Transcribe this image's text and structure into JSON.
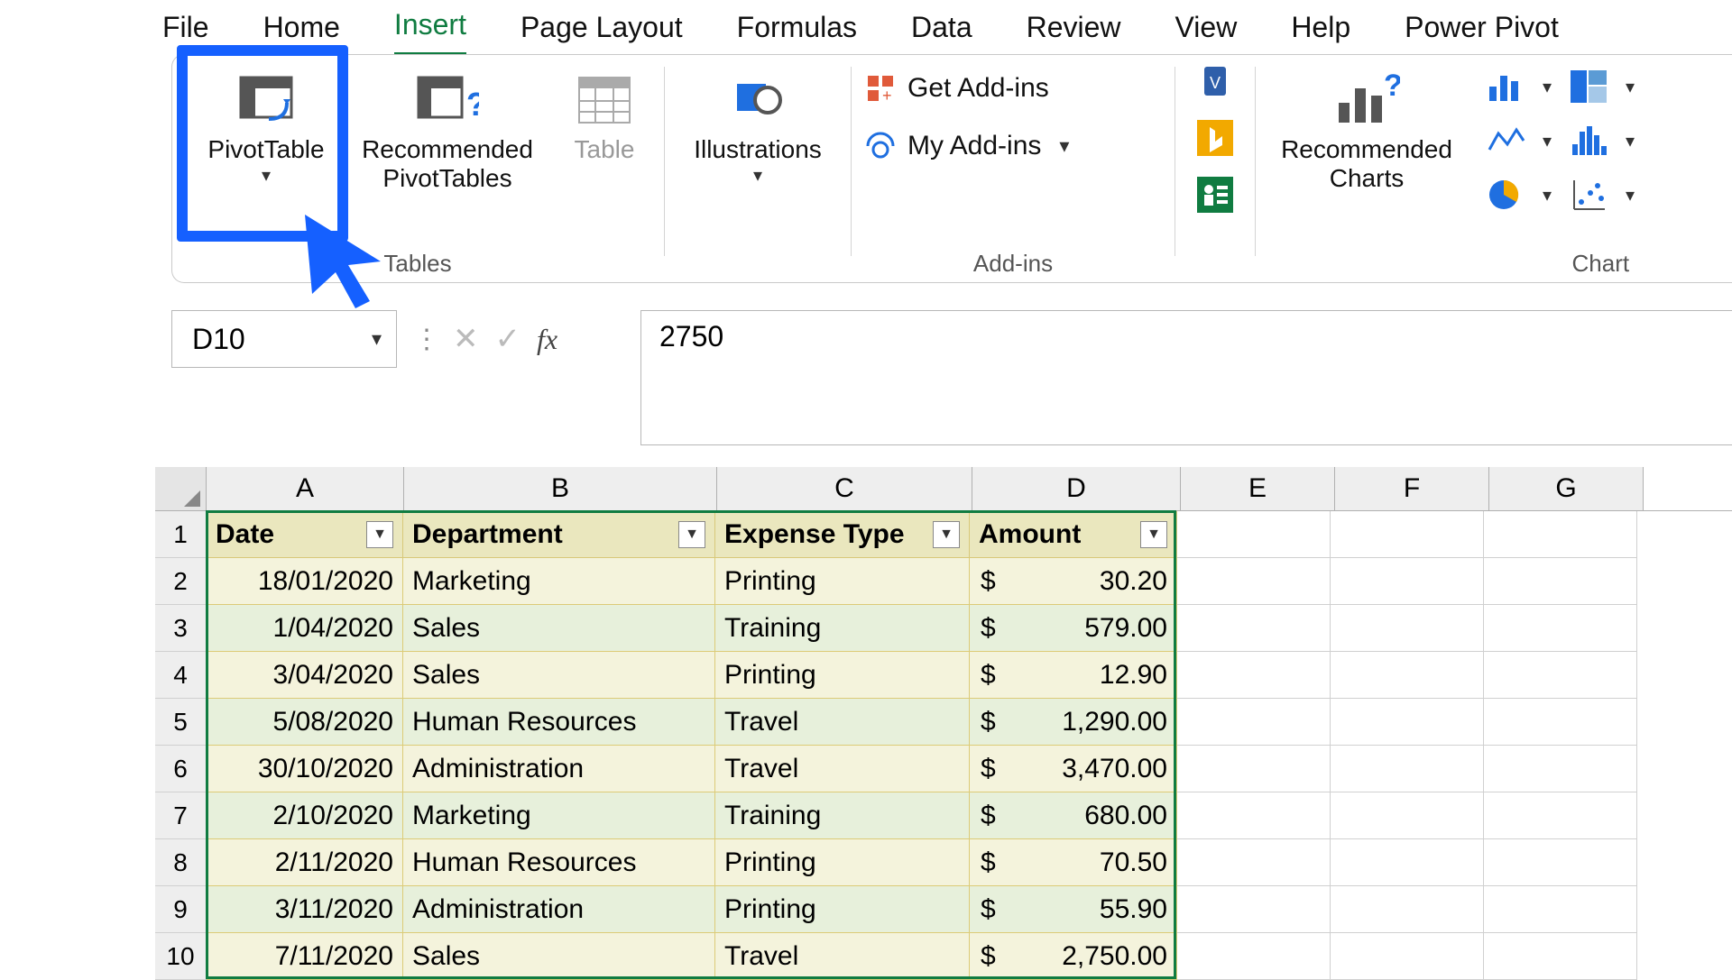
{
  "menu": {
    "tabs": [
      "File",
      "Home",
      "Insert",
      "Page Layout",
      "Formulas",
      "Data",
      "Review",
      "View",
      "Help",
      "Power Pivot"
    ],
    "active": "Insert"
  },
  "ribbon": {
    "tables": {
      "pivot": "PivotTable",
      "recommended_pivot_l1": "Recommended",
      "recommended_pivot_l2": "PivotTables",
      "table": "Table",
      "group": "Tables"
    },
    "illustrations": {
      "label": "Illustrations"
    },
    "addins": {
      "get": "Get Add-ins",
      "my": "My Add-ins",
      "group": "Add-ins"
    },
    "charts": {
      "recommended_l1": "Recommended",
      "recommended_l2": "Charts",
      "group": "Chart"
    }
  },
  "namebox": "D10",
  "formula": "2750",
  "columns": [
    "A",
    "B",
    "C",
    "D",
    "E",
    "F",
    "G"
  ],
  "headers": [
    "Date",
    "Department",
    "Expense Type",
    "Amount"
  ],
  "rows": [
    {
      "n": 1
    },
    {
      "n": 2,
      "date": "18/01/2020",
      "dept": "Marketing",
      "type": "Printing",
      "amount": "30.20"
    },
    {
      "n": 3,
      "date": "1/04/2020",
      "dept": "Sales",
      "type": "Training",
      "amount": "579.00"
    },
    {
      "n": 4,
      "date": "3/04/2020",
      "dept": "Sales",
      "type": "Printing",
      "amount": "12.90"
    },
    {
      "n": 5,
      "date": "5/08/2020",
      "dept": "Human Resources",
      "type": "Travel",
      "amount": "1,290.00"
    },
    {
      "n": 6,
      "date": "30/10/2020",
      "dept": "Administration",
      "type": "Travel",
      "amount": "3,470.00"
    },
    {
      "n": 7,
      "date": "2/10/2020",
      "dept": "Marketing",
      "type": "Training",
      "amount": "680.00"
    },
    {
      "n": 8,
      "date": "2/11/2020",
      "dept": "Human Resources",
      "type": "Printing",
      "amount": "70.50"
    },
    {
      "n": 9,
      "date": "3/11/2020",
      "dept": "Administration",
      "type": "Printing",
      "amount": "55.90"
    },
    {
      "n": 10,
      "date": "7/11/2020",
      "dept": "Sales",
      "type": "Travel",
      "amount": "2,750.00"
    }
  ],
  "currency_symbol": "$"
}
